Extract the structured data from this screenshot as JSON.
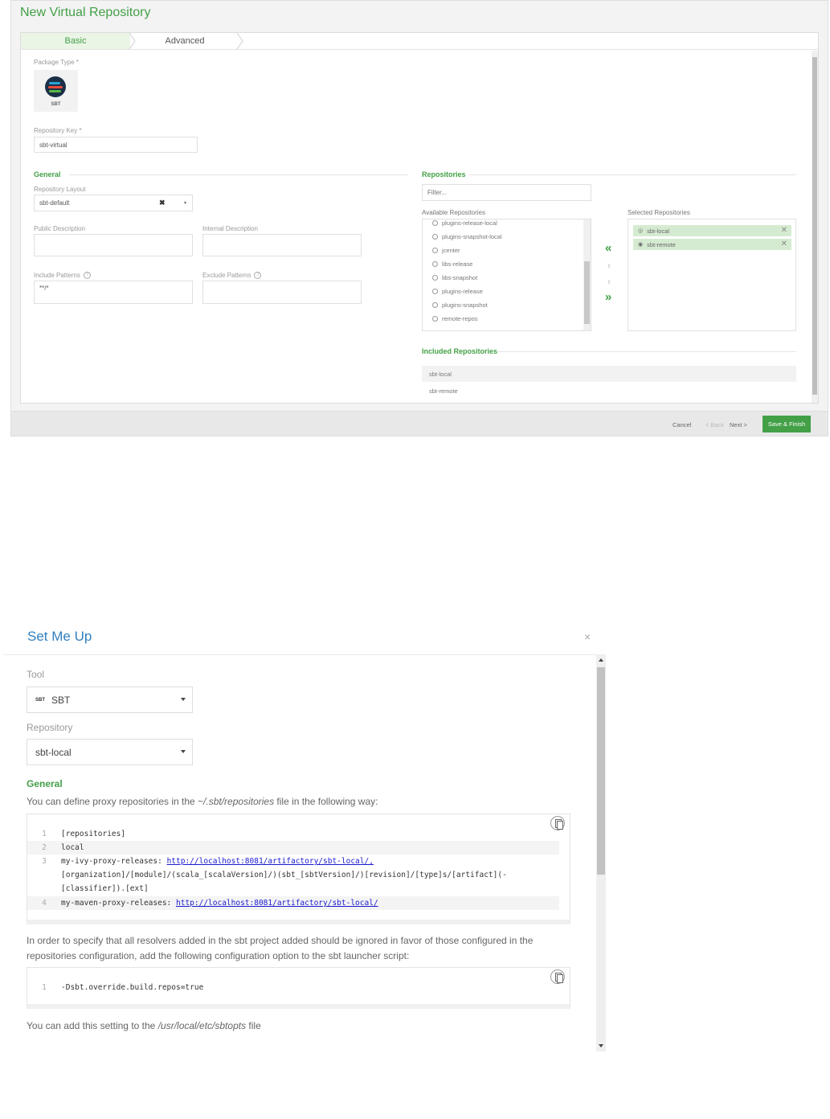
{
  "wizard": {
    "title": "New Virtual Repository",
    "tabs": {
      "basic": "Basic",
      "advanced": "Advanced"
    },
    "package_type_label": "Package Type *",
    "package_type_value": "SBT",
    "repository_key_label": "Repository Key *",
    "repository_key_value": "sbt-virtual",
    "general": {
      "heading": "General",
      "repository_layout_label": "Repository Layout",
      "repository_layout_value": "sbt-default",
      "public_description_label": "Public Description",
      "internal_description_label": "Internal Description",
      "include_patterns_label": "Include Patterns",
      "include_patterns_value": "**/*",
      "exclude_patterns_label": "Exclude Patterns"
    },
    "repositories": {
      "heading": "Repositories",
      "filter_placeholder": "Filter...",
      "available_label": "Available Repositories",
      "available": [
        "plugins-release-local",
        "plugins-snapshot-local",
        "jcenter",
        "libs-release",
        "libs-snapshot",
        "plugins-release",
        "plugins-snapshot",
        "remote-repos"
      ],
      "selected_label": "Selected Repositories",
      "selected": [
        "sbt-local",
        "sbt-remote"
      ],
      "move_all_left": "«",
      "move_left": "‹",
      "move_right": "›",
      "move_all_right": "»"
    },
    "included": {
      "heading": "Included Repositories",
      "items": [
        "sbt-local",
        "sbt-remote"
      ]
    },
    "footer": {
      "cancel": "Cancel",
      "back": "< Back",
      "next": "Next >",
      "save": "Save & Finish"
    }
  },
  "setmeup": {
    "title": "Set Me Up",
    "close": "×",
    "tool_label": "Tool",
    "tool_badge": "SBT",
    "tool_value": "SBT",
    "repository_label": "Repository",
    "repository_value": "sbt-local",
    "general_heading": "General",
    "para1_pre": "You can define proxy repositories in the ",
    "para1_em": "~/.sbt/repositories",
    "para1_post": " file in the following way:",
    "code1": [
      {
        "n": "1",
        "text": "[repositories]"
      },
      {
        "n": "2",
        "text": "local"
      },
      {
        "n": "3",
        "text": "my-ivy-proxy-releases: ",
        "link": "http://localhost:8081/artifactory/sbt-local/,"
      },
      {
        "n": "",
        "text": "[organization]/[module]/(scala_[scalaVersion]/)(sbt_[sbtVersion]/)[revision]/[type]s/[artifact](-"
      },
      {
        "n": "",
        "text": "[classifier]).[ext]"
      },
      {
        "n": "4",
        "text": "my-maven-proxy-releases: ",
        "link": "http://localhost:8081/artifactory/sbt-local/"
      }
    ],
    "para2": "In order to specify that all resolvers added in the sbt project added should be ignored in favor of those configured in the repositories configuration, add the following configuration option to the sbt launcher script:",
    "code2": [
      {
        "n": "1",
        "text": "-Dsbt.override.build.repos=true"
      }
    ],
    "para3_pre": "You can add this setting to the ",
    "para3_em": "/usr/local/etc/sbtopts",
    "para3_post": " file"
  },
  "colors": {
    "green": "#43a047",
    "blue": "#2f7fc1",
    "link": "#1a1ad0"
  }
}
